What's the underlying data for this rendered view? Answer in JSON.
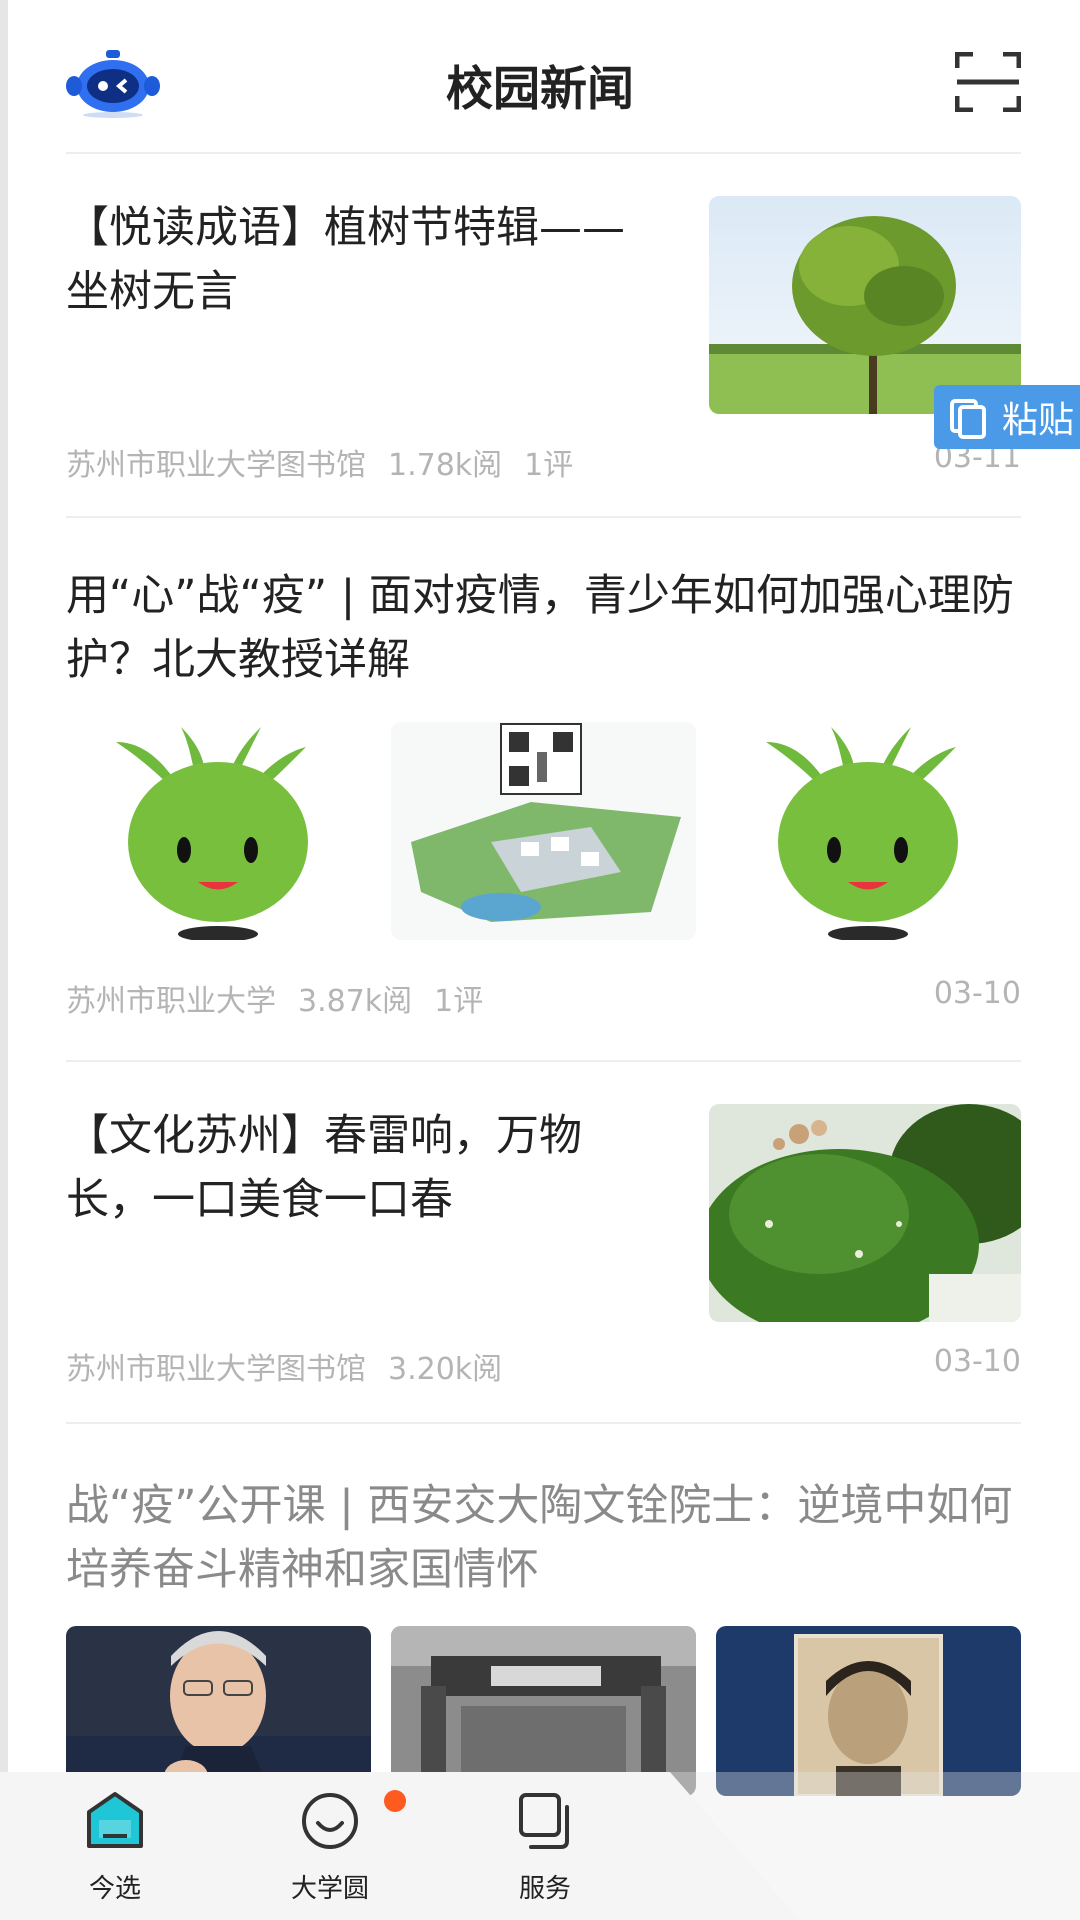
{
  "header": {
    "title": "校园新闻",
    "logo_icon": "robot-mascot-icon",
    "scan_icon": "scan-icon"
  },
  "articles": [
    {
      "title": "【悦读成语】植树节特辑——坐树无言",
      "source": "苏州市职业大学图书馆",
      "views": "1.78k阅",
      "comments": "1评",
      "date": "03-11",
      "layout": "right-thumbnail",
      "images": [
        "single tree in a green field"
      ]
    },
    {
      "title": "用“心”战“疫” | 面对疫情，青少年如何加强心理防护？北大教授详解",
      "source": "苏州市职业大学",
      "views": "3.87k阅",
      "comments": "1评",
      "date": "03-10",
      "layout": "three-thumbnails",
      "images": [
        "green radish mascot",
        "campus model map with QR code",
        "green radish mascot"
      ]
    },
    {
      "title": "【文化苏州】春雷响，万物长，一口美食一口春",
      "source": "苏州市职业大学图书馆",
      "views": "3.20k阅",
      "date": "03-10",
      "layout": "right-thumbnail",
      "images": [
        "mound of green vegetables"
      ]
    },
    {
      "title": "战“疫”公开课 | 西安交大陶文铨院士：逆境中如何培养奋斗精神和家国情怀",
      "layout": "three-thumbnails",
      "images": [
        "portrait of elderly man",
        "old campus gate photo",
        "vintage portrait photo"
      ]
    }
  ],
  "tooltip": {
    "paste_label": "粘贴",
    "icon": "clipboard-icon"
  },
  "tabbar": {
    "tabs": [
      {
        "label": "今选",
        "icon": "home-icon",
        "active": true
      },
      {
        "label": "大学圆",
        "icon": "smile-icon",
        "badge": true
      },
      {
        "label": "服务",
        "icon": "cards-icon"
      }
    ]
  },
  "colors": {
    "accent_blue": "#1e8be0",
    "badge_orange": "#ff5a1f",
    "paste_blue": "#4b9ae8"
  }
}
